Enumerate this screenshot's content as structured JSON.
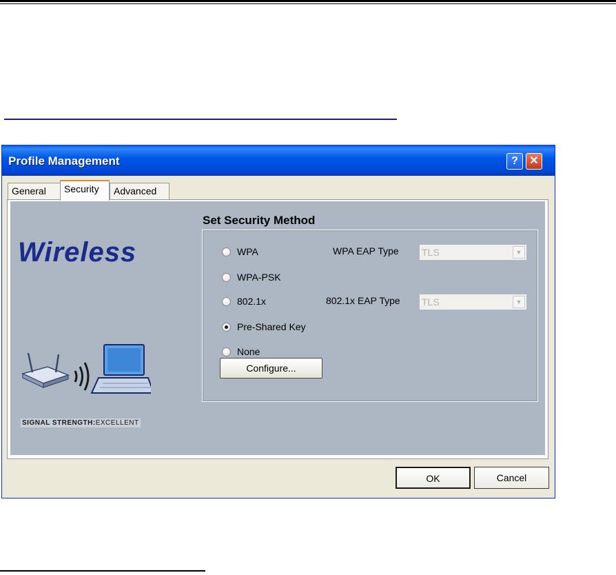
{
  "dialog": {
    "title": "Profile Management",
    "help_glyph": "?",
    "close_glyph": "✕"
  },
  "tabs": [
    {
      "label": "General",
      "active": false
    },
    {
      "label": "Security",
      "active": true
    },
    {
      "label": "Advanced",
      "active": false
    }
  ],
  "brand": {
    "logo_text": "Wireless",
    "signal_label": "SIGNAL STRENGTH:",
    "signal_value": "EXCELLENT"
  },
  "security": {
    "heading": "Set Security Method",
    "options": [
      {
        "label": "WPA",
        "checked": false
      },
      {
        "label": "WPA-PSK",
        "checked": false
      },
      {
        "label": "802.1x",
        "checked": false
      },
      {
        "label": "Pre-Shared Key",
        "checked": true
      },
      {
        "label": "None",
        "checked": false
      }
    ],
    "wpa_eap_label": "WPA EAP Type",
    "wpa_eap_value": "TLS",
    "dot1x_eap_label": "802.1x EAP Type",
    "dot1x_eap_value": "TLS",
    "configure_label": "Configure..."
  },
  "footer": {
    "ok_label": "OK",
    "cancel_label": "Cancel"
  },
  "colors": {
    "titlebar": "#0058e6",
    "panel": "#adb7c3",
    "logo": "#1a2b8c",
    "active_tab_accent": "#e68b2c"
  }
}
